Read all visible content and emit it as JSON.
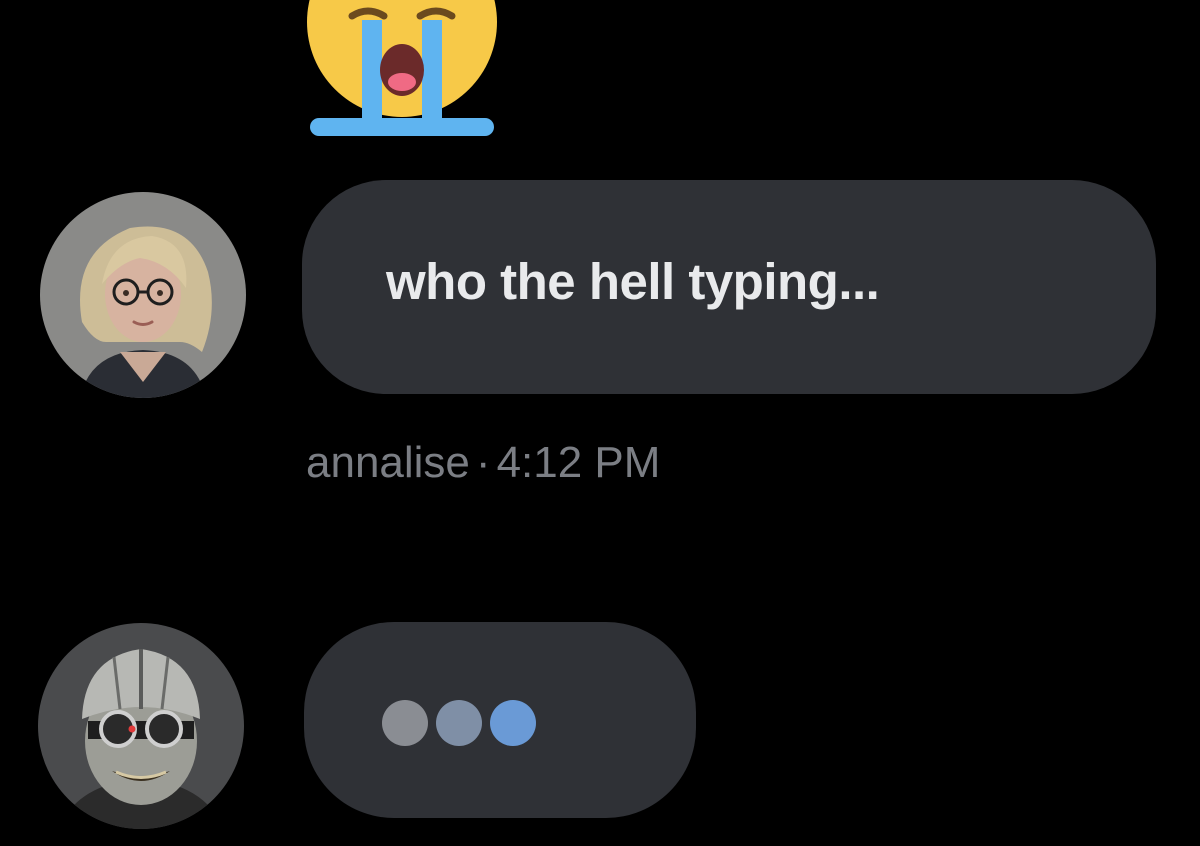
{
  "reaction": {
    "icon": "crying-face-emoji"
  },
  "messages": [
    {
      "avatar_icon": "woman-with-glasses-avatar",
      "text": "who the hell typing...",
      "author": "annalise",
      "separator": "·",
      "time": "4:12 PM"
    }
  ],
  "typing": {
    "avatar_icon": "masked-figure-avatar",
    "dots": [
      "typing-dot",
      "typing-dot",
      "typing-dot"
    ],
    "colors": {
      "bubble": "#2f3136",
      "dot_1": "#8a8d93",
      "dot_2": "#7f8fa6",
      "dot_3": "#6a9ad6"
    }
  },
  "colors": {
    "background": "#000000",
    "bubble": "#2f3136",
    "message_text": "#e9eaec",
    "meta_text": "#7b7e84"
  }
}
